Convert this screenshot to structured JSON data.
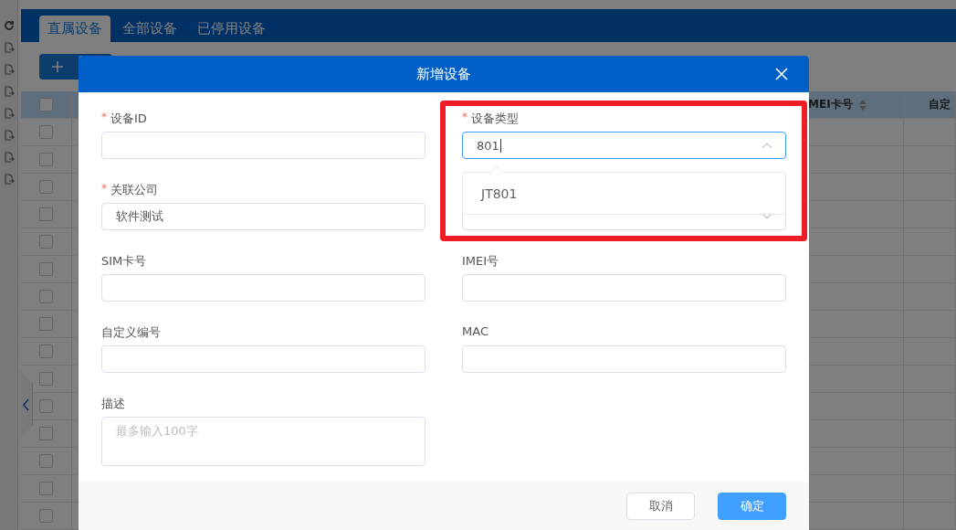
{
  "tabs": [
    {
      "label": "直属设备",
      "selected": true
    },
    {
      "label": "全部设备",
      "selected": false
    },
    {
      "label": "已停用设备",
      "selected": false
    }
  ],
  "table": {
    "header_checked": false,
    "columns": [
      "MEI卡号",
      "自定"
    ],
    "rows": [
      {
        "checked": false
      },
      {
        "checked": false
      },
      {
        "checked": false
      },
      {
        "checked": false
      },
      {
        "checked": false
      },
      {
        "checked": false
      },
      {
        "checked": false
      },
      {
        "checked": false
      },
      {
        "checked": false
      },
      {
        "checked": false
      },
      {
        "checked": false
      },
      {
        "checked": false
      },
      {
        "checked": false
      },
      {
        "checked": false
      },
      {
        "checked": false
      }
    ]
  },
  "dialog": {
    "title": "新增设备",
    "fields": [
      {
        "kind": "input",
        "label": "设备ID",
        "required_mark": "*",
        "highlighted": false
      },
      {
        "kind": "select",
        "label": "设备类型",
        "required_mark": "*",
        "value": "801",
        "focused": true,
        "expanded": true,
        "options": [
          "JT801"
        ],
        "highlighted": true
      },
      {
        "kind": "input",
        "label": "关联公司",
        "required_mark": "*",
        "value": "软件测试",
        "highlighted": false
      },
      {
        "kind": "select",
        "highlighted": false
      },
      {
        "kind": "input",
        "label": "SIM卡号",
        "highlighted": false
      },
      {
        "kind": "input",
        "label": "IMEI号",
        "highlighted": false
      },
      {
        "kind": "input",
        "label": "自定义编号",
        "highlighted": false
      },
      {
        "kind": "input",
        "label": "MAC",
        "highlighted": false
      },
      {
        "kind": "textarea",
        "label": "描述",
        "placeholder": "最多输入100字",
        "highlighted": false
      }
    ],
    "buttons": [
      {
        "label": "取消",
        "kind": "secondary"
      },
      {
        "label": "确定",
        "kind": "primary"
      }
    ]
  }
}
